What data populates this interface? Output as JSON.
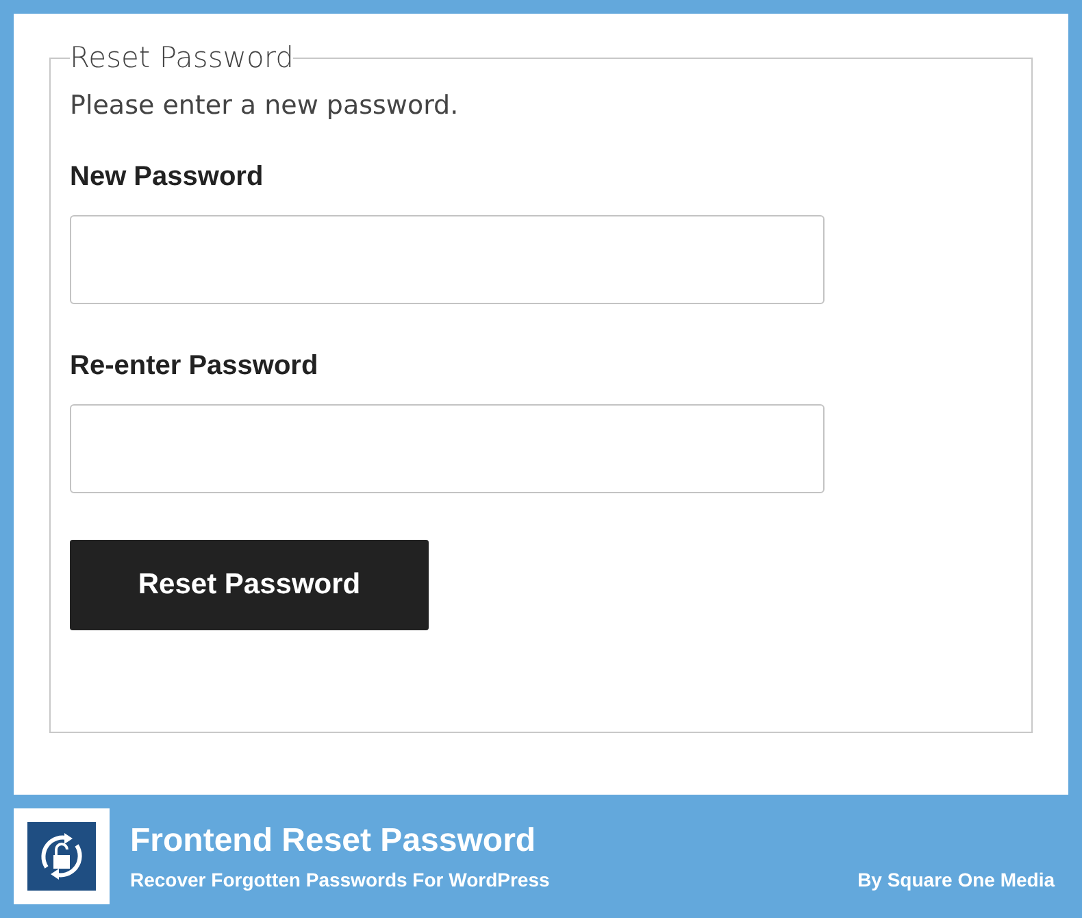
{
  "form": {
    "legend": "Reset Password",
    "intro": "Please enter a new password.",
    "fields": [
      {
        "label": "New Password"
      },
      {
        "label": "Re-enter Password"
      }
    ],
    "submit": "Reset Password"
  },
  "banner": {
    "title": "Frontend Reset Password",
    "subtitle": "Recover Forgotten Passwords For WordPress",
    "author": "By Square One Media"
  }
}
